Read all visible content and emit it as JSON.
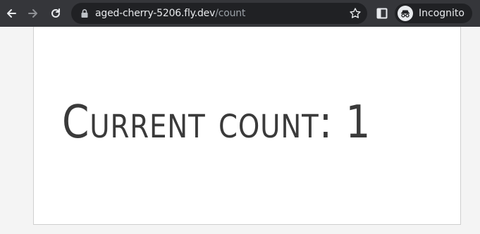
{
  "browser": {
    "url_host": "aged-cherry-5206.fly.dev",
    "url_path": "/count",
    "profile_label": "Incognito",
    "icons": [
      "back-arrow-icon",
      "forward-arrow-icon",
      "reload-icon",
      "lock-icon",
      "star-icon",
      "tab-search-icon",
      "incognito-icon"
    ]
  },
  "page": {
    "heading": "Current count: 1"
  }
}
